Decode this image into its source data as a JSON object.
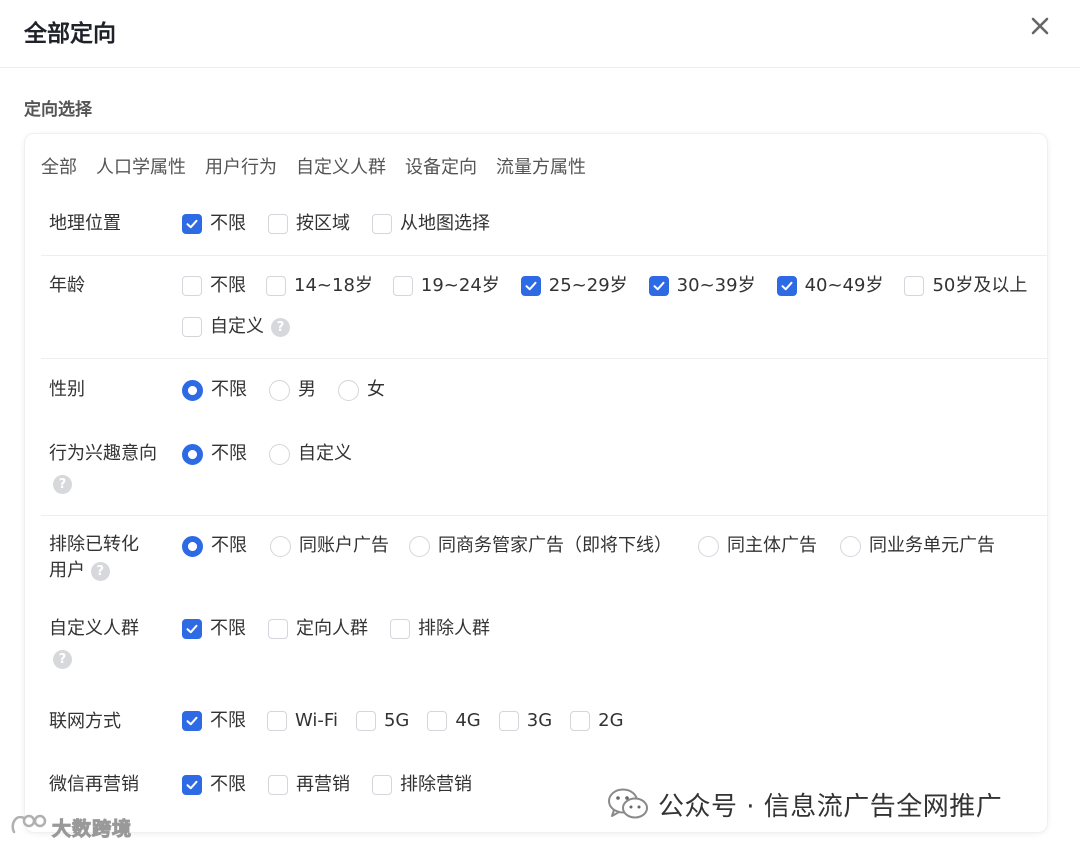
{
  "dialog": {
    "title": "全部定向"
  },
  "section": {
    "title": "定向选择"
  },
  "tabs": [
    "全部",
    "人口学属性",
    "用户行为",
    "自定义人群",
    "设备定向",
    "流量方属性"
  ],
  "rows": [
    {
      "label": "地理位置",
      "type": "checkbox",
      "options": [
        {
          "label": "不限",
          "checked": true
        },
        {
          "label": "按区域",
          "checked": false
        },
        {
          "label": "从地图选择",
          "checked": false
        }
      ]
    },
    {
      "label": "年龄",
      "type": "checkbox",
      "options": [
        {
          "label": "不限",
          "checked": false
        },
        {
          "label": "14~18岁",
          "checked": false
        },
        {
          "label": "19~24岁",
          "checked": false
        },
        {
          "label": "25~29岁",
          "checked": true
        },
        {
          "label": "30~39岁",
          "checked": true
        },
        {
          "label": "40~49岁",
          "checked": true
        },
        {
          "label": "50岁及以上",
          "checked": false
        }
      ],
      "extra_option": {
        "label": "自定义",
        "checked": false
      }
    },
    {
      "label": "性别",
      "type": "radio",
      "options": [
        {
          "label": "不限",
          "checked": true
        },
        {
          "label": "男",
          "checked": false
        },
        {
          "label": "女",
          "checked": false
        }
      ]
    },
    {
      "label": "行为兴趣意向",
      "type": "radio",
      "options": [
        {
          "label": "不限",
          "checked": true
        },
        {
          "label": "自定义",
          "checked": false
        }
      ]
    },
    {
      "label_line1": "排除已转化",
      "label_line2": "用户",
      "type": "radio",
      "options": [
        {
          "label": "不限",
          "checked": true
        },
        {
          "label": "同账户广告",
          "checked": false
        },
        {
          "label": "同商务管家广告（即将下线）",
          "checked": false
        },
        {
          "label": "同主体广告",
          "checked": false
        },
        {
          "label": "同业务单元广告",
          "checked": false
        }
      ]
    },
    {
      "label": "自定义人群",
      "type": "checkbox",
      "options": [
        {
          "label": "不限",
          "checked": true
        },
        {
          "label": "定向人群",
          "checked": false
        },
        {
          "label": "排除人群",
          "checked": false
        }
      ]
    },
    {
      "label": "联网方式",
      "type": "checkbox",
      "options": [
        {
          "label": "不限",
          "checked": true
        },
        {
          "label": "Wi-Fi",
          "checked": false
        },
        {
          "label": "5G",
          "checked": false
        },
        {
          "label": "4G",
          "checked": false
        },
        {
          "label": "3G",
          "checked": false
        },
        {
          "label": "2G",
          "checked": false
        }
      ]
    },
    {
      "label": "微信再营销",
      "type": "checkbox",
      "options": [
        {
          "label": "不限",
          "checked": true
        },
        {
          "label": "再营销",
          "checked": false
        },
        {
          "label": "排除营销",
          "checked": false
        }
      ]
    }
  ],
  "help_glyph": "?",
  "icons": {
    "close": "close-icon",
    "help": "question-circle-icon",
    "wechat": "wechat-icon"
  },
  "colors": {
    "accent": "#2d6ae3",
    "border": "#d4d6db",
    "help": "#d6d8dc"
  },
  "watermark": {
    "left": "大数跨境",
    "right": "公众号 · 信息流广告全网推广"
  }
}
